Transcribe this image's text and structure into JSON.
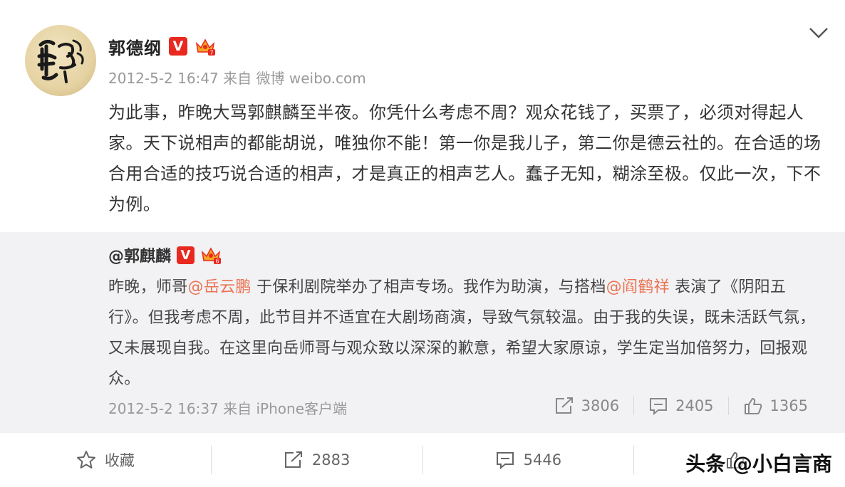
{
  "post": {
    "author": "郭德纲",
    "verified_badge": "V",
    "timestamp": "2012-5-2 16:47",
    "source": "来自 微博 weibo.com",
    "text": "为此事，昨晚大骂郭麒麟至半夜。你凭什么考虑不周？观众花钱了，买票了，必须对得起人家。天下说相声的都能胡说，唯独你不能！第一你是我儿子，第二你是德云社的。在合适的场合用合适的技巧说合适的相声，才是真正的相声艺人。蠢子无知，糊涂至极。仅此一次，下不为例。"
  },
  "repost": {
    "author": "@郭麒麟",
    "verified_badge": "V",
    "text_before": "昨晚，师哥",
    "mention1": "@岳云鹏",
    "text_middle": " 于保利剧院举办了相声专场。我作为助演，与搭档",
    "mention2": "@阎鹤祥",
    "text_after": " 表演了《阴阳五行》。但我考虑不周，此节目并不适宜在大剧场商演，导致气氛较温。由于我的失误，既未活跃气氛，又未展现自我。在这里向岳师哥与观众致以深深的歉意，希望大家原谅，学生定当加倍努力，回报观众。",
    "timestamp": "2012-5-2 16:37",
    "source": "来自 iPhone客户端",
    "stats": {
      "reposts": "3806",
      "comments": "2405",
      "likes": "1365"
    }
  },
  "actions": {
    "favorite_label": "收藏",
    "repost_count": "2883",
    "comment_count": "5446",
    "like_count": ""
  },
  "watermark": "头条 @小白言商",
  "colors": {
    "mention": "#eb7350",
    "verified": "#e8291f",
    "crown": "#f5a623",
    "repost_bg": "#f2f2f5"
  },
  "icons": [
    "chevron-down-icon",
    "crown-icon",
    "repost-icon",
    "comment-icon",
    "like-icon",
    "star-icon"
  ]
}
